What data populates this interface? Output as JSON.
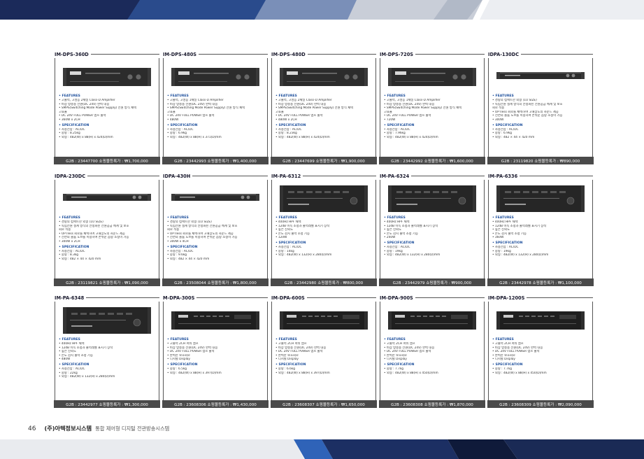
{
  "footer": {
    "page_number": "46",
    "company": "(주)아텍정보시스템",
    "tagline": "통합 제어형 디지털 전관방송시스템"
  },
  "labels": {
    "features": "• FEATURES",
    "specification": "• SPECIFICATION"
  },
  "products": [
    {
      "name": "IM-DPS-360D",
      "device": "dps-2u",
      "features": [
        "• 고출력, 고성능 2채널 Class-D Amplifier",
        "• 비상 방송용 전원(DC 24V) 완벽 대응",
        "• SMPS(Switching Mode Power Supply) 전원 방식 채택",
        "고효율",
        "• DC 24V FULL POWER 앰프 출력",
        "• 360W x 2CH"
      ],
      "specs": [
        "• 사용전압 : AC/DC",
        "• 중량 : 8.25kg",
        "• 외형 : 482(W) x 88(H) x 424(D)mm"
      ],
      "price": "G2B : 23447700   쇼핑몰등록가 : ₩1,700,000"
    },
    {
      "name": "IM-DPS-480S",
      "device": "dps-2u",
      "features": [
        "• 고출력, 고성능 1채널 Class-D Amplifier",
        "• 비상 방송용 전원(DC 24V) 완벽 대응",
        "• SMPS(Switching Mode Power Supply) 전원 방식 채택",
        "고효율",
        "• DC 24V FULL POWER 앰프 출력",
        "• 480W"
      ],
      "specs": [
        "• 사용전압 : AC/DC",
        "• 중량 : 6.9kg",
        "• 외형 : 482(W) x 88(H) x 371(D)mm"
      ],
      "price": "G2B : 23442993   쇼핑몰등록가 : ₩1,400,000"
    },
    {
      "name": "IM-DPS-480D",
      "device": "dps-2u",
      "features": [
        "• 고출력, 고성능 2채널 Class-D Amplifier",
        "• 비상 방송용 전원(DC 24V) 완벽 대응",
        "• SMPS(Switching Mode Power Supply) 전원 방식 채택",
        "고효율",
        "• DC 24V FULL POWER 앰프 출력",
        "• 480W x 2CH"
      ],
      "specs": [
        "• 사용전압 : AC/DC",
        "• 중량 : 8.23kg",
        "• 외형 : 482(W) x 88(H) x 424(D)mm"
      ],
      "price": "G2B : 23447699   쇼핑몰등록가 : ₩1,900,000"
    },
    {
      "name": "IM-DPS-720S",
      "device": "dps-2u",
      "features": [
        "• 고출력, 고성능 1채널 Class-D Amplifier",
        "• 비상 방송용 전원(DC 24V) 완벽 대응",
        "• SMPS(Switching Mode Power Supply) 전원 방식 채택",
        "고효율",
        "• DC 24V FULL POWER 앰프 출력",
        "• 720W"
      ],
      "specs": [
        "• 사용전압 : AC/DC",
        "• 중량 : 7.96kg",
        "• 외형 : 482(W) x 88(H) x 424(D)mm"
      ],
      "price": "G2B : 23442992   쇼핑몰등록가 : ₩1,600,000"
    },
    {
      "name": "IDPA-130DC",
      "device": "slim-1u",
      "features": [
        "• 경량의 컴팩트한 외형 (1U SIZE)",
        "• 독립전원 설계 방식의 안정화된 전원공급 체계 및 보호",
        "회로 적용",
        "• OPTless 회로를 채택하여 고해상도의 사운드 제공",
        "• 전면의 볼륨 노브를 이용하여 손쉬운 음량 조정이 가능",
        "• 300W"
      ],
      "specs": [
        "• 사용전압 : AC/DC",
        "• 중량 : 6.9kg",
        "• 외형 : 482 × 44 × 420 mm"
      ],
      "price": "G2B : 23119820   쇼핑몰등록가 : ₩890,000"
    },
    {
      "name": "IDPA-230DC",
      "device": "slim-1u",
      "features": [
        "• 경량의 컴팩트한 외형 (1U SIZE)",
        "• 독립전원 설계 방식의 안정화된 전원공급 체계 및 보호",
        "회로 적용",
        "• OPTless 회로를 채택하여 고해상도의 사운드 제공",
        "• 전면의 볼륨 노브를 이용하여 손쉬운 음량 조정이 가능",
        "• 300W x 2CH"
      ],
      "specs": [
        "• 사용전압 : AC/DC",
        "• 중량 : 8.3kg",
        "• 외형 : 482 × 44 × 420 mm"
      ],
      "price": "G2B : 23119821   쇼핑몰등록가 : ₩1,090,000"
    },
    {
      "name": "IDPA-430H",
      "device": "slim-1u",
      "features": [
        "• 경량의 컴팩트한 외형 (1U SIZE)",
        "• 독립전원 설계 방식의 안정화된 전원공급 체계 및 보호",
        "회로 적용",
        "• OPTless 회로를 채택하여 고해상도의 사운드 제공",
        "• 전면의 볼륨 노브를 이용하여 손쉬운 음량 조정이 가능",
        "• 300W x 4CH"
      ],
      "specs": [
        "• 사용전압 : AC/DC",
        "• 중량 : 9.6kg",
        "• 외형 : 482 × 44 × 420 mm"
      ],
      "price": "G2B : 23508044   쇼핑몰등록가 : ₩1,800,000"
    },
    {
      "name": "IM-PA-6312",
      "device": "pa-3u",
      "features": [
        "• 400Hz HPF 채택",
        "• 12dB 이득 조정과 출력레벨 표시기 장착",
        "• 높은 신뢰도",
        "• 온도 감지 출력 조정 기능",
        "• 120W"
      ],
      "specs": [
        "• 사용전압 : AC/DC",
        "• 중량 : 14kg",
        "• 외형 : 482(W) x 132(H) x 280(D)mm"
      ],
      "price": "G2B : 23442980   쇼핑몰등록가 : ₩800,000"
    },
    {
      "name": "IM-PA-6324",
      "device": "pa-3u",
      "features": [
        "• 400Hz HPF 채택",
        "• 12dB 이득 조정과 출력레벨 표시기 장착",
        "• 높은 신뢰도",
        "• 온도 감지 출력 조정 기능",
        "• 240W"
      ],
      "specs": [
        "• 사용전압 : AC/DC",
        "• 중량 : 19kg",
        "• 외형 : 482(W) x 132(H) x 280(D)mm"
      ],
      "price": "G2B : 23442979   쇼핑몰등록가 : ₩900,000"
    },
    {
      "name": "IM-PA-6336",
      "device": "pa-3u",
      "features": [
        "• 400Hz HPF 채택",
        "• 12dB 이득 조정과 출력레벨 표시기 장착",
        "• 높은 신뢰도",
        "• 온도 감지 출력 조정 기능",
        "• 360W"
      ],
      "specs": [
        "• 사용전압 : AC/DC",
        "• 중량 : 19kg",
        "• 외형 : 482(W) x 132(H) x 280(D)mm"
      ],
      "price": "G2B : 23442978   쇼핑몰등록가 : ₩1,100,000"
    },
    {
      "name": "IM-PA-6348",
      "device": "pa-3u",
      "features": [
        "• 400Hz HPF 채택",
        "• 12dB 이득 조정과 출력레벨 표시기 장착",
        "• 높은 신뢰도",
        "• 온도 감지 출력 조정 기능",
        "• 480W"
      ],
      "specs": [
        "• 사용전압 : AC/DC",
        "• 중량 : 22kg",
        "• 외형 : 482(W) x 132(H) x 280(D)mm"
      ],
      "price": "G2B : 23442977   쇼핑몰등록가 : ₩1,300,000"
    },
    {
      "name": "M-DPA-300S",
      "device": "mdpa-2u",
      "features": [
        "• 고출력 2CH 파워 앰프",
        "• 비상 방송용 전원(DC 24V) 완벽 대응",
        "• DC 24V FULL POWER 앰프 출력",
        "• 완벽한 보호회로",
        "• 디지털 Display"
      ],
      "specs": [
        "• 중량 : 6.5kg",
        "• 외형 : 482(W) x 88(H) x 397(D)mm"
      ],
      "price": "G2B : 23608306   쇼핑몰등록가 : ₩1,430,000"
    },
    {
      "name": "IM-DPA-600S",
      "device": "mdpa-2u",
      "features": [
        "• 고출력 2CH 파워 앰프",
        "• 비상 방송용 전원(DC 24V) 완벽 대응",
        "• DC 24V FULL POWER 앰프 출력",
        "• 완벽한 보호회로",
        "• 디지털 Display"
      ],
      "specs": [
        "• 중량 : 6.6kg",
        "• 외형 : 482(W) x 88(H) x 397(D)mm"
      ],
      "price": "G2B : 23608307   쇼핑몰등록가 : ₩1,650,000"
    },
    {
      "name": "IM-DPA-900S",
      "device": "mdpa-2u",
      "features": [
        "• 고출력 2CH 파워 앰프",
        "• 비상 방송용 전원(DC 24V) 완벽 대응",
        "• DC 24V FULL POWER 앰프 출력",
        "• 완벽한 보호회로",
        "• 디지털 Display"
      ],
      "specs": [
        "• 중량 : 7.7kg",
        "• 외형 : 482(W) x 88(H) x 450(D)mm"
      ],
      "price": "G2B : 23608308   쇼핑몰등록가 : ₩1,870,000"
    },
    {
      "name": "IM-DPA-1200S",
      "device": "mdpa-2u",
      "features": [
        "• 고출력 2CH 파워 앰프",
        "• 비상 방송용 전원(DC 24V) 완벽 대응",
        "• DC 24V FULL POWER 앰프 출력",
        "• 완벽한 보호회로",
        "• 디지털 Display"
      ],
      "specs": [
        "• 중량 : 7.7kg",
        "• 외형 : 482(W) x 88(H) x 450(D)mm"
      ],
      "price": "G2B : 23608309   쇼핑몰등록가 : ₩2,090,000"
    }
  ]
}
